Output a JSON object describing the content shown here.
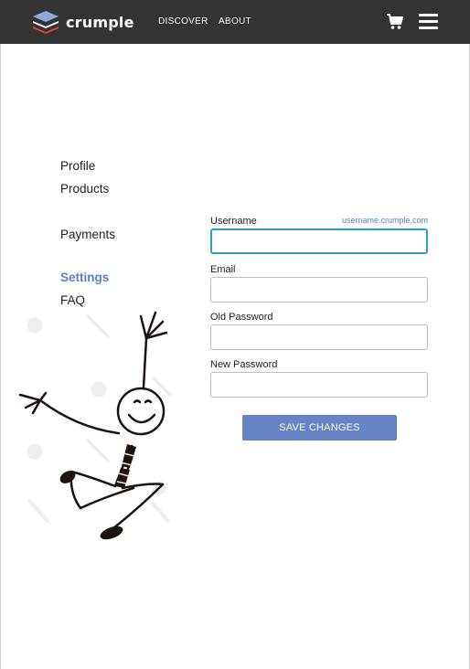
{
  "header": {
    "logo_text": "crumple",
    "nav": [
      {
        "label": "DISCOVER"
      },
      {
        "label": "ABOUT"
      }
    ],
    "icons": [
      "cart-icon",
      "hamburger-menu-icon"
    ]
  },
  "sidebar": {
    "items": [
      {
        "label": "Profile"
      },
      {
        "label": "Products"
      },
      {
        "label": "Payments"
      },
      {
        "label": "Settings",
        "active": true
      },
      {
        "label": "FAQ"
      }
    ]
  },
  "form": {
    "username": {
      "label": "Username",
      "hint": "username.crumple.com",
      "value": ""
    },
    "email": {
      "label": "Email",
      "value": ""
    },
    "old_password": {
      "label": "Old Password",
      "value": ""
    },
    "new_password": {
      "label": "New Password",
      "value": ""
    },
    "save_label": "SAVE CHANGES"
  },
  "colors": {
    "header_bg": "#333333",
    "accent": "#5b80c2",
    "button": "#6683c3",
    "focus": "#2a9fd0"
  }
}
